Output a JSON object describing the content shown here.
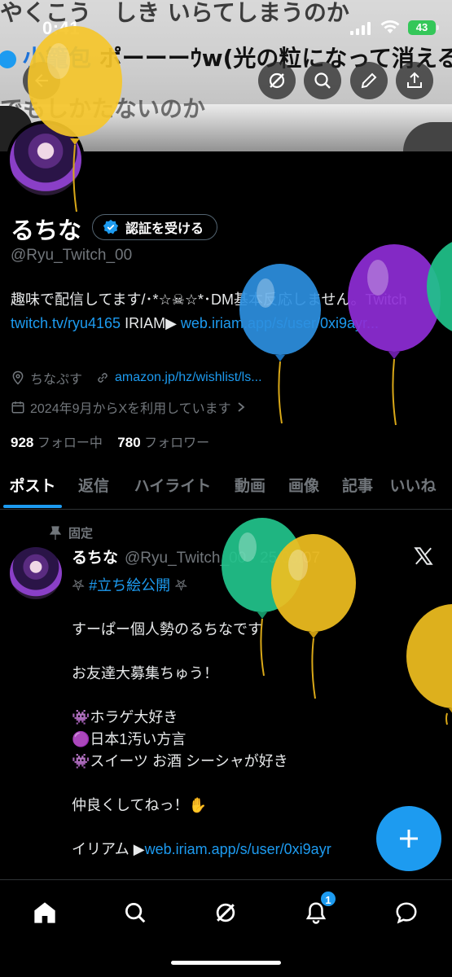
{
  "status_bar": {
    "time": "0:41",
    "battery": "43"
  },
  "banner": {
    "line1": "やくこう　しき いらてしまうのか",
    "line2_name": "小籠包",
    "line2_text": "ポーーーｳw(光の粒になって消える)",
    "line3": "でもしかたないのか"
  },
  "profile": {
    "name": "るちな",
    "verify_label": "認証を受ける",
    "handle": "@Ryu_Twitch_00",
    "bio_text_1": "趣味で配信してます/･*☆",
    "bio_skull": "☠",
    "bio_text_2": "☆*･DM基本反応しません。Twitch ",
    "bio_link_twitch": "twitch.tv/ryu4165",
    "bio_text_3": " IRIAM▶ ",
    "bio_link_iriam": "web.iriam.app/s/user/0xi9ayr...",
    "location": "ちなぷす",
    "wishlist_link": "amazon.jp/hz/wishlist/ls...",
    "joined": "2024年9月からXを利用しています",
    "following_count": "928",
    "following_label": "フォロー中",
    "followers_count": "780",
    "followers_label": "フォロワー"
  },
  "tabs": [
    "ポスト",
    "返信",
    "ハイライト",
    "動画",
    "画像",
    "記事",
    "いいね"
  ],
  "pinned_tweet": {
    "pinned_label": "固定",
    "name": "るちな",
    "handle": "@Ryu_Twitch_00 · 25/05/07",
    "hashtag_line": "#立ち絵公開",
    "line1": "すーぱー個人勢のるちなです",
    "line2": "お友達大募集ちゅう！",
    "line3": "👾ホラゲ大好き",
    "line4": "🟣日本1汚い方言",
    "line5": "👾スイーツ お酒 シーシャが好き",
    "line6": "仲良くしてねっ！✋",
    "line7_prefix": "イリアム ▶",
    "line7_link": "web.iriam.app/s/user/0xi9ayr"
  },
  "bottom_nav": {
    "notification_badge": "1"
  },
  "colors": {
    "accent": "#1d9bf0",
    "background": "#000000",
    "muted": "#71767b"
  }
}
